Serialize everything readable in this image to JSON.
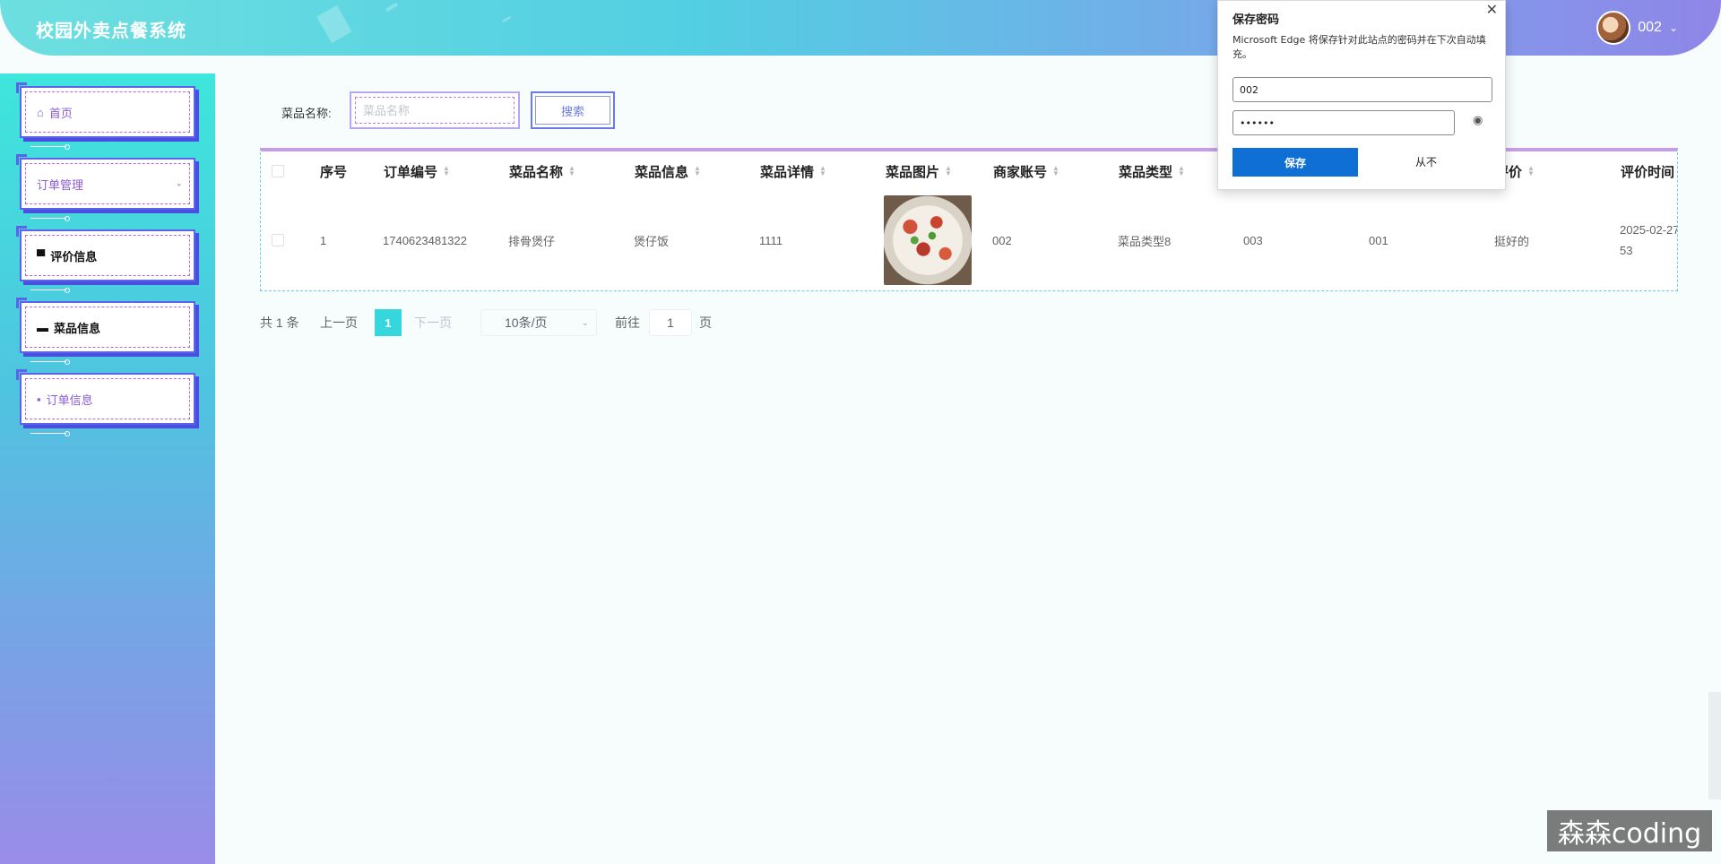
{
  "header": {
    "title": "校园外卖点餐系统",
    "username": "002",
    "caret": "⌄"
  },
  "sidebar": {
    "items": [
      {
        "label": "首页",
        "icon": "home-icon",
        "glyph": "⌂"
      },
      {
        "label": "订单管理",
        "icon": "none",
        "glyph": "",
        "arrow": "⌄"
      },
      {
        "label": "评价信息",
        "icon": "basket-icon",
        "glyph": "▀"
      },
      {
        "label": "菜品信息",
        "icon": "folder-icon",
        "glyph": "▬"
      },
      {
        "label": "订单信息",
        "icon": "note-icon",
        "glyph": "▪"
      }
    ]
  },
  "search": {
    "label": "菜品名称:",
    "placeholder": "菜品名称",
    "button": "搜索"
  },
  "table": {
    "columns": [
      "序号",
      "订单编号",
      "菜品名称",
      "菜品信息",
      "菜品详情",
      "菜品图片",
      "商家账号",
      "菜品类型",
      "评价",
      "评价时间"
    ],
    "sort_glyphs": {
      "up": "▲",
      "down": "▼"
    },
    "rows": [
      {
        "index": "1",
        "order_no": "1740623481322",
        "dish_name": "排骨煲仔",
        "dish_info": "煲仔饭",
        "dish_detail": "1111",
        "merchant": "002",
        "dish_type": "菜品类型8",
        "col_a": "003",
        "col_b": "001",
        "review": "挺好的",
        "review_time_1": "2025-02-27",
        "review_time_2": "53"
      }
    ]
  },
  "pager": {
    "total": "共 1 条",
    "prev": "上一页",
    "current": "1",
    "next": "下一页",
    "page_size": "10条/页",
    "goto": "前往",
    "goto_value": "1",
    "page_unit": "页"
  },
  "edge_popup": {
    "title": "保存密码",
    "close": "✕",
    "description": "Microsoft Edge 将保存针对此站点的密码并在下次自动填充。",
    "username": "002",
    "password": "••••••",
    "eye": "◉",
    "save": "保存",
    "never": "从不"
  },
  "watermark": "森森coding",
  "colors": {
    "accent_cyan": "#35d7dc",
    "menu_border": "#5b64e8",
    "edge_blue": "#0f6fd4"
  }
}
